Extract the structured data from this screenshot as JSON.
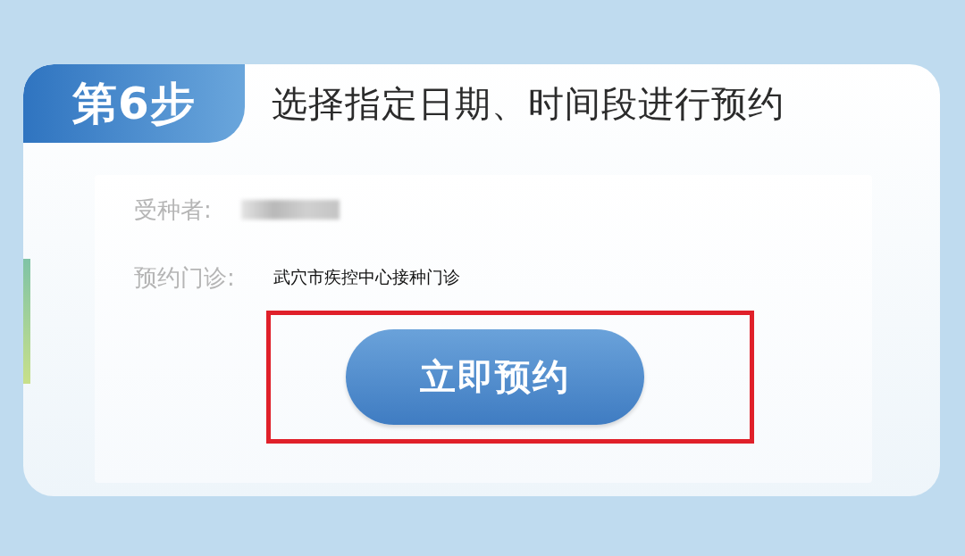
{
  "step": {
    "label": "第6步",
    "title": "选择指定日期、时间段进行预约"
  },
  "fields": [
    {
      "kind": "blurred",
      "label": "受种者:"
    },
    {
      "kind": "text",
      "label": "预约门诊:",
      "value": "武穴市疾控中心接种门诊"
    }
  ],
  "button": {
    "label": "立即预约",
    "highlighted": true
  }
}
